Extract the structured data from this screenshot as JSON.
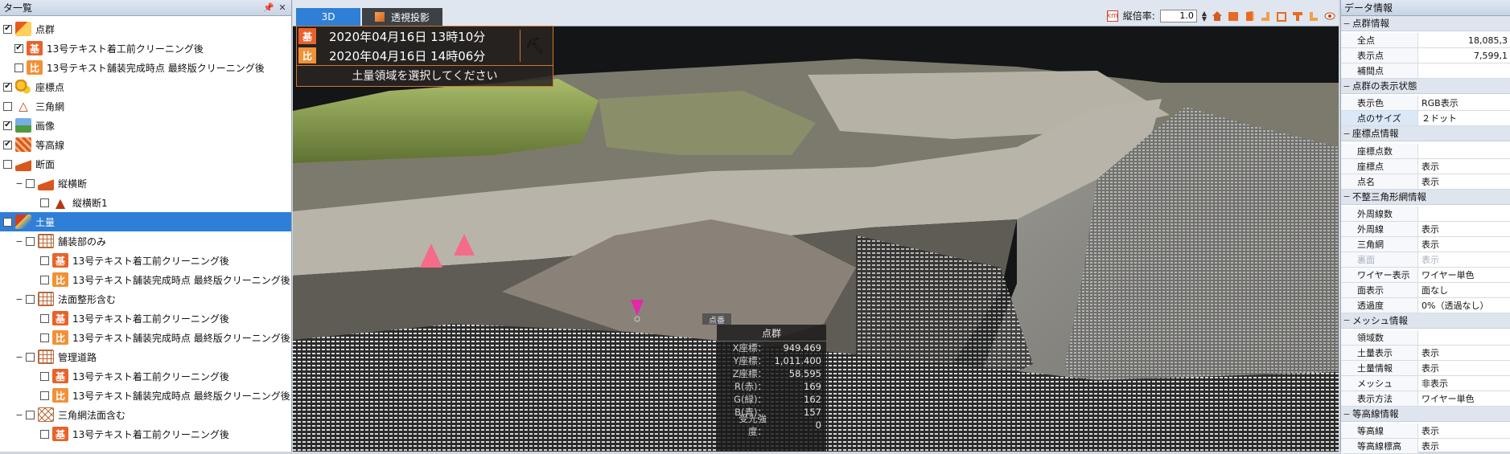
{
  "left_panel": {
    "title": "タ一覧",
    "pin_icon": "pin-icon",
    "close_icon": "close-icon",
    "rows": [
      {
        "label": "点群",
        "icon": "point-cloud-icon",
        "checked": true,
        "indent": 0,
        "expander": ""
      },
      {
        "label": "13号テキスト着工前クリーニング後",
        "icon": "base-tag-icon",
        "checked": true,
        "indent": 1,
        "expander": "",
        "tag": "基"
      },
      {
        "label": "13号テキスト舗装完成時点 最終版クリーニング後",
        "icon": "compare-tag-icon",
        "checked": false,
        "indent": 1,
        "expander": "",
        "tag": "比"
      },
      {
        "label": "座標点",
        "icon": "coordinate-point-icon",
        "checked": true,
        "indent": 0,
        "expander": ""
      },
      {
        "label": "三角網",
        "icon": "triangle-mesh-icon",
        "checked": false,
        "indent": 0,
        "expander": ""
      },
      {
        "label": "画像",
        "icon": "image-icon",
        "checked": true,
        "indent": 0,
        "expander": ""
      },
      {
        "label": "等高線",
        "icon": "contour-icon",
        "checked": true,
        "indent": 0,
        "expander": ""
      },
      {
        "label": "断面",
        "icon": "section-icon",
        "checked": false,
        "indent": 0,
        "expander": ""
      },
      {
        "label": "縦横断",
        "icon": "section-icon",
        "checked": false,
        "indent": 1,
        "expander": "−"
      },
      {
        "label": "縦横断1",
        "icon": "warning-section-icon",
        "checked": false,
        "indent": 2,
        "expander": ""
      },
      {
        "label": "土量",
        "icon": "volume-icon",
        "checked": false,
        "indent": 0,
        "expander": "",
        "selected": true
      },
      {
        "label": "舗装部のみ",
        "icon": "grid-icon",
        "checked": false,
        "indent": 1,
        "expander": "−"
      },
      {
        "label": "13号テキスト着工前クリーニング後",
        "icon": "base-tag-icon",
        "checked": false,
        "indent": 2,
        "expander": "",
        "tag": "基"
      },
      {
        "label": "13号テキスト舗装完成時点 最終版クリーニング後",
        "icon": "compare-tag-icon",
        "checked": false,
        "indent": 2,
        "expander": "",
        "tag": "比"
      },
      {
        "label": "法面整形含む",
        "icon": "grid-icon",
        "checked": false,
        "indent": 1,
        "expander": "−"
      },
      {
        "label": "13号テキスト着工前クリーニング後",
        "icon": "base-tag-icon",
        "checked": false,
        "indent": 2,
        "expander": "",
        "tag": "基"
      },
      {
        "label": "13号テキスト舗装完成時点 最終版クリーニング後",
        "icon": "compare-tag-icon",
        "checked": false,
        "indent": 2,
        "expander": "",
        "tag": "比"
      },
      {
        "label": "管理道路",
        "icon": "grid-icon",
        "checked": false,
        "indent": 1,
        "expander": "−"
      },
      {
        "label": "13号テキスト着工前クリーニング後",
        "icon": "base-tag-icon",
        "checked": false,
        "indent": 2,
        "expander": "",
        "tag": "基"
      },
      {
        "label": "13号テキスト舗装完成時点 最終版クリーニング後",
        "icon": "compare-tag-icon",
        "checked": false,
        "indent": 2,
        "expander": "",
        "tag": "比"
      },
      {
        "label": "三角網法面含む",
        "icon": "triangle-grid-icon",
        "checked": false,
        "indent": 1,
        "expander": "−"
      },
      {
        "label": "13号テキスト着工前クリーニング後",
        "icon": "base-tag-icon",
        "checked": false,
        "indent": 2,
        "expander": "",
        "tag": "基"
      }
    ]
  },
  "viewer": {
    "tab_3d": "3D",
    "tab_perspective": "透視投影",
    "zoom_label": "縦倍率:",
    "zoom_value": "1.0",
    "dates": {
      "base_tag": "基",
      "base_date": "2020年04月16日 13時10分",
      "compare_tag": "比",
      "compare_date": "2020年04月16日 14時06分",
      "message": "土量領域を選択してください"
    },
    "point_info": {
      "marker_label": "点番",
      "title": "点群",
      "rows": [
        {
          "k": "X座標：",
          "v": "949.469"
        },
        {
          "k": "Y座標：",
          "v": "1,011.400"
        },
        {
          "k": "Z座標：",
          "v": "58.595"
        },
        {
          "k": "R(赤)：",
          "v": "169"
        },
        {
          "k": "G(緑)：",
          "v": "162"
        },
        {
          "k": "B(青)：",
          "v": "157"
        },
        {
          "k": "受光強度：",
          "v": "0"
        }
      ]
    }
  },
  "right_panel": {
    "title": "データ情報",
    "sections": [
      {
        "title": "点群情報",
        "rows": [
          {
            "k": "全点",
            "v": "18,085,3",
            "num": true
          },
          {
            "k": "表示点",
            "v": "7,599,1",
            "num": true
          },
          {
            "k": "補間点",
            "v": ""
          }
        ]
      },
      {
        "title": "点群の表示状態",
        "rows": [
          {
            "k": "表示色",
            "v": "RGB表示"
          },
          {
            "k": "点のサイズ",
            "v": "２ドット",
            "hl": true
          }
        ]
      },
      {
        "title": "座標点情報",
        "rows": [
          {
            "k": "座標点数",
            "v": ""
          },
          {
            "k": "座標点",
            "v": "表示"
          },
          {
            "k": "点名",
            "v": "表示"
          }
        ]
      },
      {
        "title": "不整三角形網情報",
        "rows": [
          {
            "k": "外周線数",
            "v": ""
          },
          {
            "k": "外周線",
            "v": "表示"
          },
          {
            "k": "三角網",
            "v": "表示"
          },
          {
            "k": "裏面",
            "v": "表示",
            "dim": true
          },
          {
            "k": "ワイヤー表示",
            "v": "ワイヤー単色"
          },
          {
            "k": "面表示",
            "v": "面なし"
          },
          {
            "k": "透過度",
            "v": "0%（透過なし）"
          }
        ]
      },
      {
        "title": "メッシュ情報",
        "rows": [
          {
            "k": "領域数",
            "v": ""
          },
          {
            "k": "土量表示",
            "v": "表示"
          },
          {
            "k": "土量情報",
            "v": "表示"
          },
          {
            "k": "メッシュ",
            "v": "非表示"
          },
          {
            "k": "表示方法",
            "v": "ワイヤー単色"
          }
        ]
      },
      {
        "title": "等高線情報",
        "rows": [
          {
            "k": "等高線",
            "v": "表示"
          },
          {
            "k": "等高線標高",
            "v": "表示"
          }
        ]
      }
    ]
  }
}
